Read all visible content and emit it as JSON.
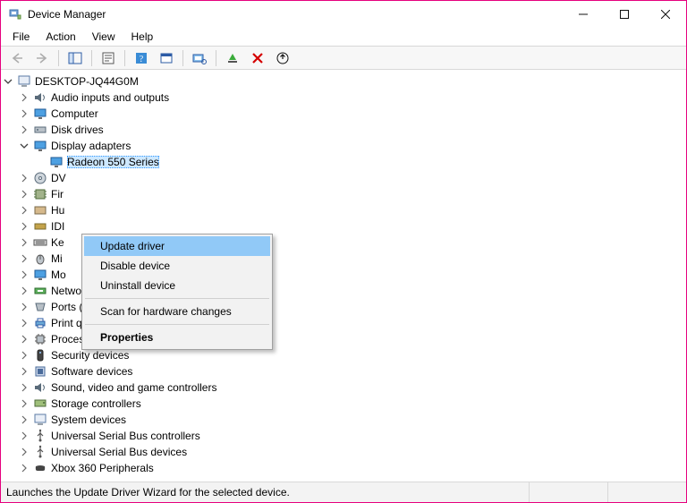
{
  "window": {
    "title": "Device Manager"
  },
  "menubar": [
    "File",
    "Action",
    "View",
    "Help"
  ],
  "tree": {
    "root": "DESKTOP-JQ44G0M",
    "items": [
      "Audio inputs and outputs",
      "Computer",
      "Disk drives",
      "Display adapters",
      "Radeon 550 Series",
      "DV",
      "Fir",
      "Hu",
      "IDI",
      "Ke",
      "Mi",
      "Mo",
      "Network adapters",
      "Ports (COM & LPT)",
      "Print queues",
      "Processors",
      "Security devices",
      "Software devices",
      "Sound, video and game controllers",
      "Storage controllers",
      "System devices",
      "Universal Serial Bus controllers",
      "Universal Serial Bus devices",
      "Xbox 360 Peripherals"
    ]
  },
  "context_menu": {
    "items": [
      "Update driver",
      "Disable device",
      "Uninstall device",
      "Scan for hardware changes",
      "Properties"
    ]
  },
  "statusbar": {
    "text": "Launches the Update Driver Wizard for the selected device."
  }
}
